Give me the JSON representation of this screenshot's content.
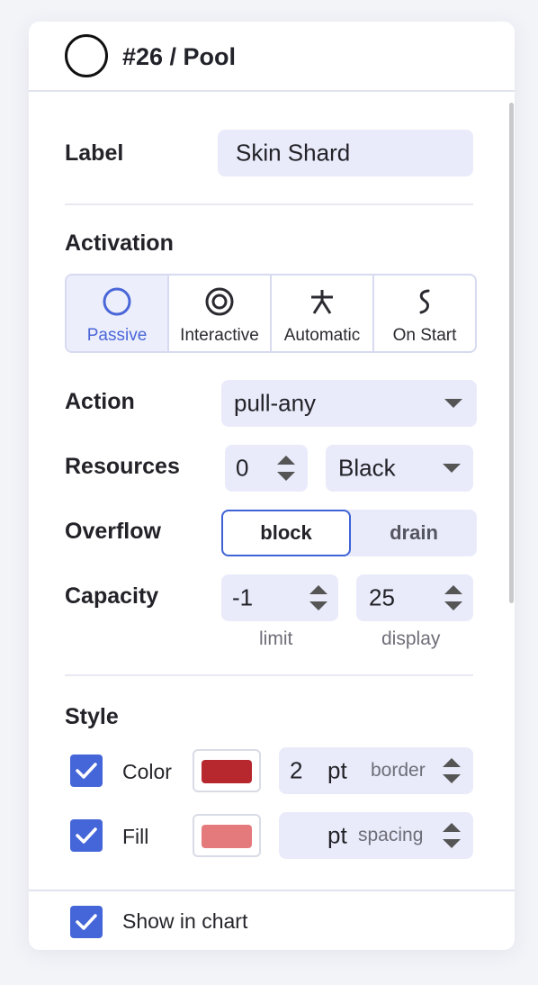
{
  "header": {
    "title": "#26 / Pool",
    "shape_icon": "circle-outline-icon"
  },
  "label_row": {
    "label": "Label",
    "value": "Skin Shard"
  },
  "activation": {
    "heading": "Activation",
    "selected": "Passive",
    "options": [
      {
        "label": "Passive",
        "icon": "circle-outline-icon"
      },
      {
        "label": "Interactive",
        "icon": "target-icon"
      },
      {
        "label": "Automatic",
        "icon": "asterisk-icon"
      },
      {
        "label": "On Start",
        "icon": "squiggle-icon"
      }
    ]
  },
  "action": {
    "label": "Action",
    "value": "pull-any"
  },
  "resources": {
    "label": "Resources",
    "count": "0",
    "color": "Black"
  },
  "overflow": {
    "label": "Overflow",
    "options": [
      "block",
      "drain"
    ],
    "selected": "block"
  },
  "capacity": {
    "label": "Capacity",
    "limit_value": "-1",
    "limit_hint": "limit",
    "display_value": "25",
    "display_hint": "display"
  },
  "style": {
    "heading": "Style",
    "color_row": {
      "checked": true,
      "label": "Color",
      "swatch": "#b7282e",
      "size_value": "2",
      "unit": "pt",
      "hint": "border"
    },
    "fill_row": {
      "checked": true,
      "label": "Fill",
      "swatch": "#e57a7d",
      "size_value": "",
      "unit": "pt",
      "hint": "spacing"
    }
  },
  "footer": {
    "checked": true,
    "label": "Show in chart"
  },
  "colors": {
    "accent": "#4566d9",
    "field_bg": "#e9ebfa"
  }
}
